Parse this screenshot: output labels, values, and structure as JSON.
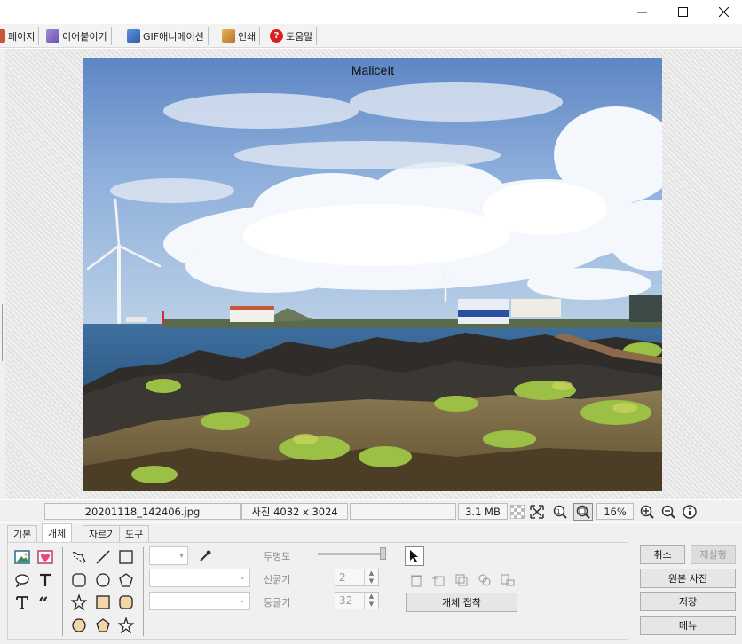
{
  "toolbar": {
    "items": [
      {
        "label": "페이지",
        "icon": "page-icon",
        "color": "#c9543b"
      },
      {
        "label": "이어붙이기",
        "icon": "attach-icon",
        "color": "#8a6fc4"
      },
      {
        "label": "GIF애니메이션",
        "icon": "gif-animation-icon",
        "color": "#3f74c6"
      },
      {
        "label": "인쇄",
        "icon": "print-icon",
        "color": "#d6973a"
      },
      {
        "label": "도움말",
        "icon": "help-icon",
        "color": "#d82020"
      }
    ]
  },
  "image": {
    "watermark": "MaliceIt"
  },
  "status": {
    "filename": "20201118_142406.jpg",
    "dimensions": "사진 4032 x 3024",
    "extra": "",
    "filesize": "3.1 MB",
    "zoom": "16%"
  },
  "tabs": [
    {
      "label": "기본",
      "active": false
    },
    {
      "label": "개체",
      "active": true
    },
    {
      "label": "자르기",
      "active": false
    },
    {
      "label": "도구",
      "active": false
    }
  ],
  "properties": {
    "opacity_label": "투명도",
    "line_width_label": "선굵기",
    "line_width_value": "2",
    "roundness_label": "둥글기",
    "roundness_value": "32",
    "merge_button": "개체 접착"
  },
  "actions": {
    "cancel": "취소",
    "redo": "재실행",
    "original": "원본 사진",
    "save": "저장",
    "menu": "메뉴"
  }
}
